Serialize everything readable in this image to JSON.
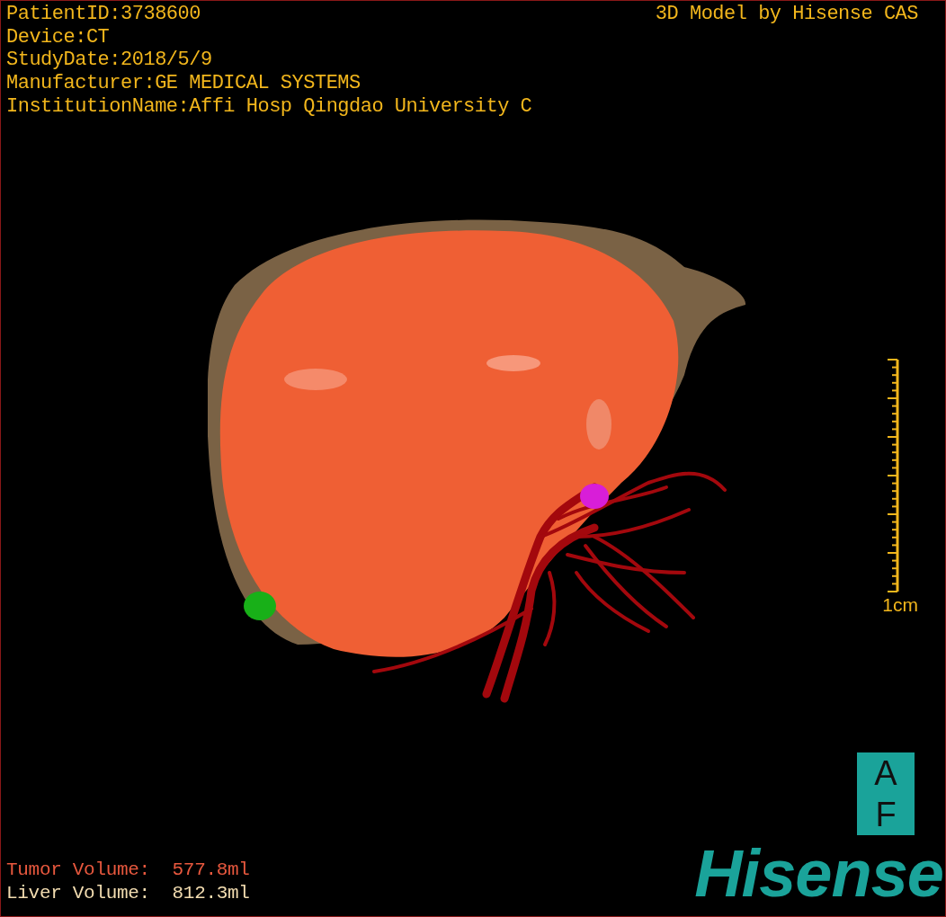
{
  "study_info": [
    "PatientID:3738600",
    "Device:CT",
    "StudyDate:2018/5/9",
    "Manufacturer:GE MEDICAL SYSTEMS",
    "InstitutionName:Affi Hosp Qingdao University C"
  ],
  "title": "3D Model by Hisense CAS",
  "scale_bar": {
    "label": "1cm"
  },
  "volumes": [
    {
      "label": "Tumor Volume:",
      "value": "577.8ml",
      "color": "#e8583e"
    },
    {
      "label": "Liver Volume:",
      "value": "812.3ml",
      "color": "#f2dcb0"
    }
  ],
  "orientation_cube": [
    "A",
    "F"
  ],
  "logo": "Hisense"
}
